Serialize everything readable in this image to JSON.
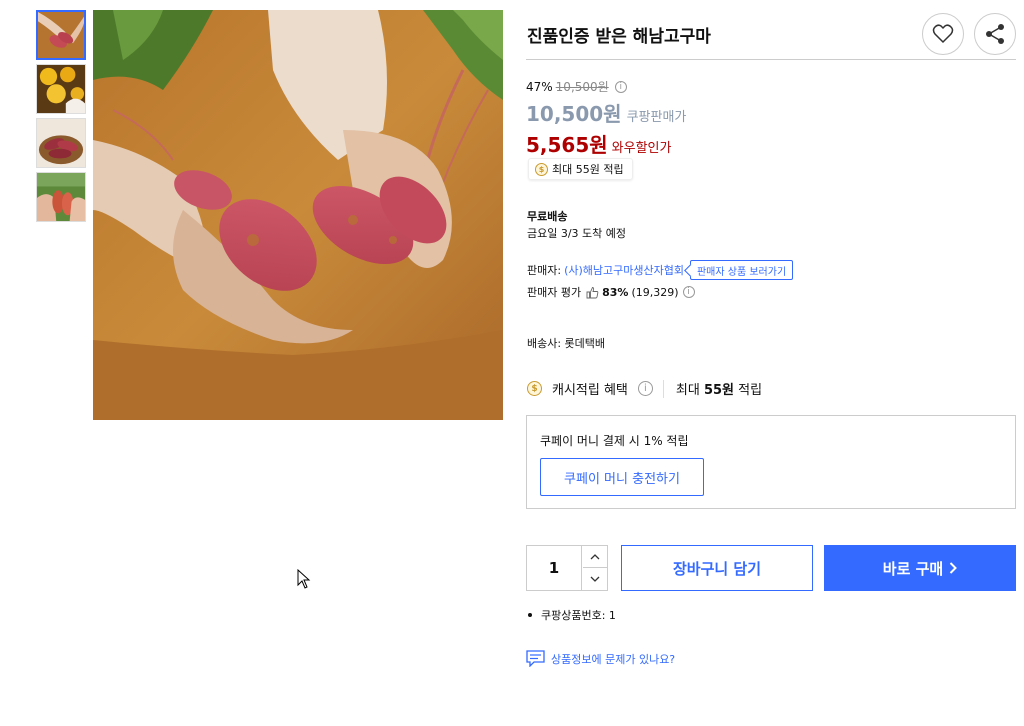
{
  "product": {
    "title": "진품인증 받은 해남고구마"
  },
  "gallery": {
    "thumbnails": [
      {
        "icon": "sweet-potato-hands-thumbnail",
        "active": true
      },
      {
        "icon": "yellow-flowers-thumbnail",
        "active": false
      },
      {
        "icon": "sweet-potatoes-basket-thumbnail",
        "active": false
      },
      {
        "icon": "sweet-potatoes-field-thumbnail",
        "active": false
      }
    ],
    "main_image": "sweet-potatoes-in-hands-image"
  },
  "actions": {
    "favorite_icon": "heart-icon",
    "share_icon": "share-icon"
  },
  "price": {
    "discount_rate": "47%",
    "original_price": "10,500원",
    "sale_price": "10,500원",
    "sale_label": "쿠팡판매가",
    "wow_price": "5,565원",
    "wow_label": "와우할인가",
    "info_icon_glyph": "i"
  },
  "reward": {
    "chip_text": "최대 55원 적립",
    "coin_glyph": "$"
  },
  "shipping": {
    "title": "무료배송",
    "date": "금요일 3/3 도착 예정",
    "carrier": "배송사: 롯데택배"
  },
  "seller": {
    "label": "판매자:",
    "name": "(사)해남고구마생산자협회",
    "view_button": "판매자 상품 보러가기",
    "rating_label": "판매자 평가",
    "rating_pct": "83%",
    "rating_count": "(19,329)"
  },
  "cash": {
    "label": "캐시적립 혜택",
    "value_prefix": "최대",
    "value_amount": "55원",
    "value_suffix": "적립"
  },
  "coupay": {
    "text": "쿠페이 머니 결제 시 1% 적립",
    "button": "쿠페이 머니 충전하기"
  },
  "purchase": {
    "quantity": "1",
    "cart_button": "장바구니 담기",
    "buy_button": "바로 구매"
  },
  "product_no": "쿠팡상품번호: 1",
  "report_link": "상품정보에 문제가 있나요?",
  "colors": {
    "accent_blue": "#346aff",
    "wow_red": "#ae0000",
    "sale_gray": "#8a99ad"
  }
}
